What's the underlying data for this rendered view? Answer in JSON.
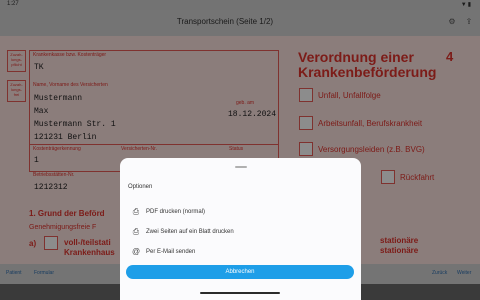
{
  "status": {
    "time": "1:27",
    "indicators": "▼▮"
  },
  "appbar": {
    "title": "Transportschein (Seite 1/2)"
  },
  "form": {
    "side_labels": [
      "Zuzah-lungs-pflicht",
      "Zuzah-lungs-frei"
    ],
    "insurer_label": "Krankenkasse bzw. Kostenträger",
    "insurer_value": "TK",
    "name_label": "Name, Vorname des Versicherten",
    "name_lines": [
      "Mustermann",
      "Max",
      "Mustermann Str. 1",
      "121231 Berlin"
    ],
    "birth_label": "geb. am",
    "birth_value": "18.12.2024",
    "cost_id_label": "Kostenträgerkennung",
    "cost_id_value": "1",
    "insured_no_label": "Versicherten-Nr.",
    "status_label": "Status",
    "bsnr_label": "Betriebsstätten-Nr.",
    "bsnr_value": "1212312",
    "title": "Verordnung einer Krankenbeförderung",
    "form_number": "4",
    "checkboxes": [
      "Unfall, Unfallfolge",
      "Arbeitsunfall, Berufskrankheit",
      "Versorgungsleiden (z.B. BVG)",
      "Rückfahrt"
    ],
    "section1": "1. Grund der Beförd",
    "section1_sub": "Genehmigungsfreie F",
    "option_a": "a)",
    "option_a_text": "voll-/teilstati",
    "option_a_text2": "Krankenhaus",
    "right_text1": "stationäre",
    "right_text2": "stationäre"
  },
  "toolbar": {
    "left1": "Patient",
    "left2": "Formular",
    "right1": "Zurück",
    "right2": "Weiter"
  },
  "sheet": {
    "title": "Optionen",
    "options": [
      {
        "icon": "printer-icon",
        "label": "PDF drucken (normal)"
      },
      {
        "icon": "printer-icon",
        "label": "Zwei Seiten auf ein Blatt drucken"
      },
      {
        "icon": "at-icon",
        "label": "Per E-Mail senden"
      }
    ],
    "cancel": "Abbrechen"
  }
}
